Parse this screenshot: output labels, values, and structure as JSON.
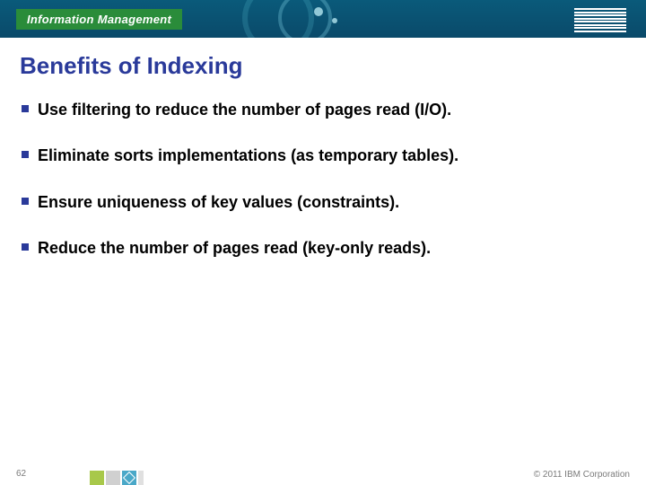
{
  "header": {
    "brand": "Information Management"
  },
  "slide": {
    "title": "Benefits of Indexing",
    "bullets": [
      "Use filtering to reduce the number of pages read (I/O).",
      "Eliminate sorts implementations (as temporary tables).",
      "Ensure uniqueness of key values (constraints).",
      "Reduce the number of pages read (key-only reads)."
    ]
  },
  "footer": {
    "page": "62",
    "copyright": "© 2011 IBM Corporation"
  }
}
